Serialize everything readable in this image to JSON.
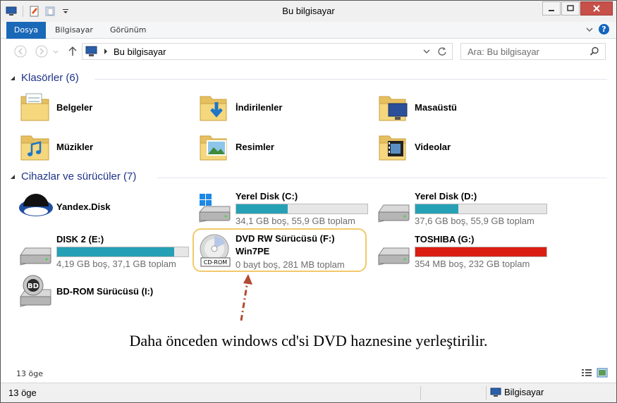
{
  "window": {
    "title": "Bu bilgisayar"
  },
  "ribbon": {
    "tabs": [
      "Dosya",
      "Bilgisayar",
      "Görünüm"
    ]
  },
  "address": {
    "path": "Bu bilgisayar",
    "search_placeholder": "Ara: Bu bilgisayar"
  },
  "folders": {
    "heading": "Klasörler (6)",
    "items": [
      "Belgeler",
      "İndirilenler",
      "Masaüstü",
      "Müzikler",
      "Resimler",
      "Videolar"
    ]
  },
  "devices": {
    "heading": "Cihazlar ve sürücüler (7)",
    "yandex": {
      "name": "Yandex.Disk"
    },
    "c": {
      "name": "Yerel Disk (C:)",
      "info": "34,1 GB boş, 55,9 GB toplam",
      "used_fraction": 0.39
    },
    "d": {
      "name": "Yerel Disk (D:)",
      "info": "37,6 GB boş, 55,9 GB toplam",
      "used_fraction": 0.33
    },
    "e": {
      "name": "DISK 2 (E:)",
      "info": "4,19 GB boş, 37,1 GB toplam",
      "used_fraction": 0.89
    },
    "f": {
      "name": "DVD RW Sürücüsü (F:)",
      "label": "Win7PE",
      "info": "0 bayt boş, 281 MB toplam",
      "badge": "CD-ROM"
    },
    "g": {
      "name": "TOSHIBA (G:)",
      "info": "354 MB boş, 232 GB toplam",
      "used_fraction": 0.998
    },
    "i": {
      "name": "BD-ROM Sürücüsü (I:)",
      "badge": "BD"
    }
  },
  "annotation": {
    "caption": "Daha önceden windows cd'si DVD haznesine yerleştirilir."
  },
  "status": {
    "item_count": "13 öge",
    "computer_label": "Bilgisayar"
  },
  "colors": {
    "accent": "#1a68b8",
    "bar": "#26a0b5",
    "bar_full": "#da1e12",
    "heading": "#1e3287",
    "highlight": "#f1c96a",
    "arrow": "#b24a33"
  }
}
